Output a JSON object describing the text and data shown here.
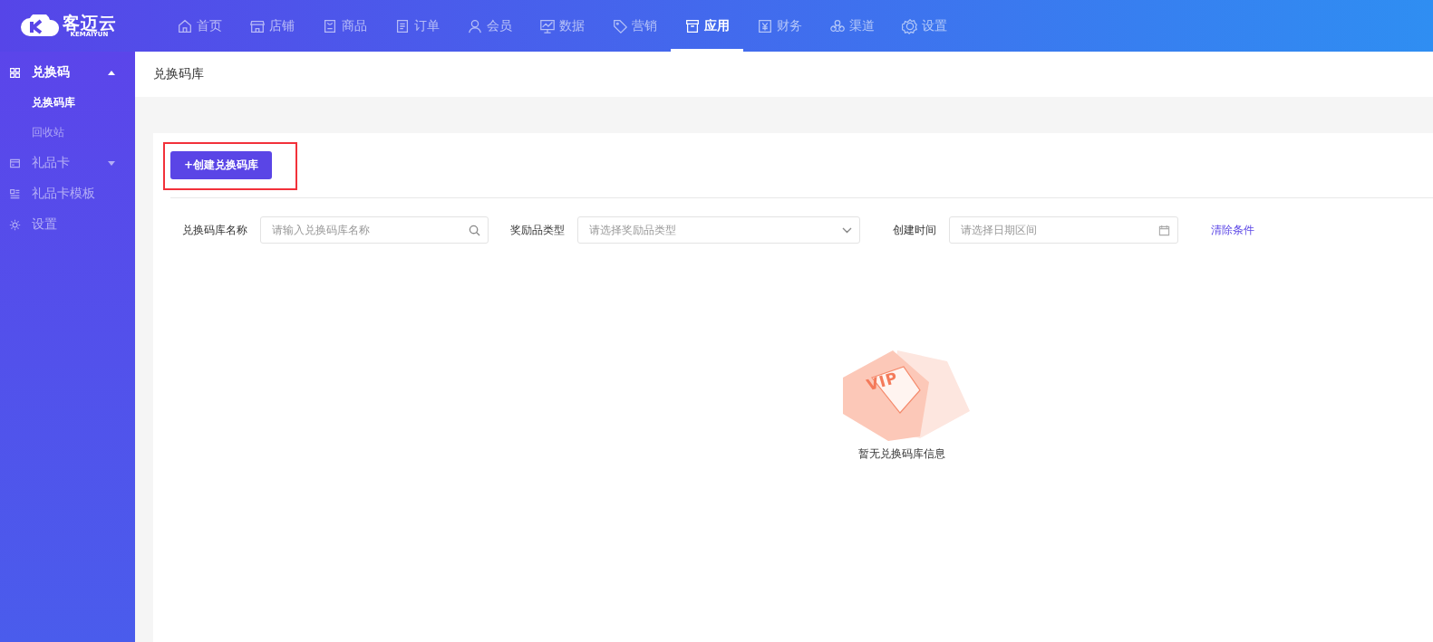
{
  "logo": {
    "name": "客迈云",
    "subtitle": "KEMAIYUN"
  },
  "nav": [
    {
      "label": "首页",
      "selected": false
    },
    {
      "label": "店铺",
      "selected": false
    },
    {
      "label": "商品",
      "selected": false
    },
    {
      "label": "订单",
      "selected": false
    },
    {
      "label": "会员",
      "selected": false
    },
    {
      "label": "数据",
      "selected": false
    },
    {
      "label": "营销",
      "selected": false
    },
    {
      "label": "应用",
      "selected": true
    },
    {
      "label": "财务",
      "selected": false
    },
    {
      "label": "渠道",
      "selected": false
    },
    {
      "label": "设置",
      "selected": false
    }
  ],
  "sidebar": {
    "items": [
      {
        "label": "兑换码",
        "expanded": true,
        "children": [
          {
            "label": "兑换码库",
            "selected": true
          },
          {
            "label": "回收站",
            "selected": false
          }
        ]
      },
      {
        "label": "礼品卡",
        "expanded": false
      },
      {
        "label": "礼品卡模板"
      },
      {
        "label": "设置"
      }
    ]
  },
  "page_title": "兑换码库",
  "create_button": {
    "label": "+创建兑换码库",
    "highlighted": true
  },
  "filters": [
    {
      "kind": "search",
      "label": "兑换码库名称",
      "placeholder": "请输入兑换码库名称"
    },
    {
      "kind": "select",
      "label": "奖励品类型",
      "placeholder": "请选择奖励品类型"
    },
    {
      "kind": "date",
      "label": "创建时间",
      "placeholder": "请选择日期区间"
    }
  ],
  "clear_link": "清除条件",
  "empty_state": {
    "badge": "VIP",
    "message": "暂无兑换码库信息"
  }
}
